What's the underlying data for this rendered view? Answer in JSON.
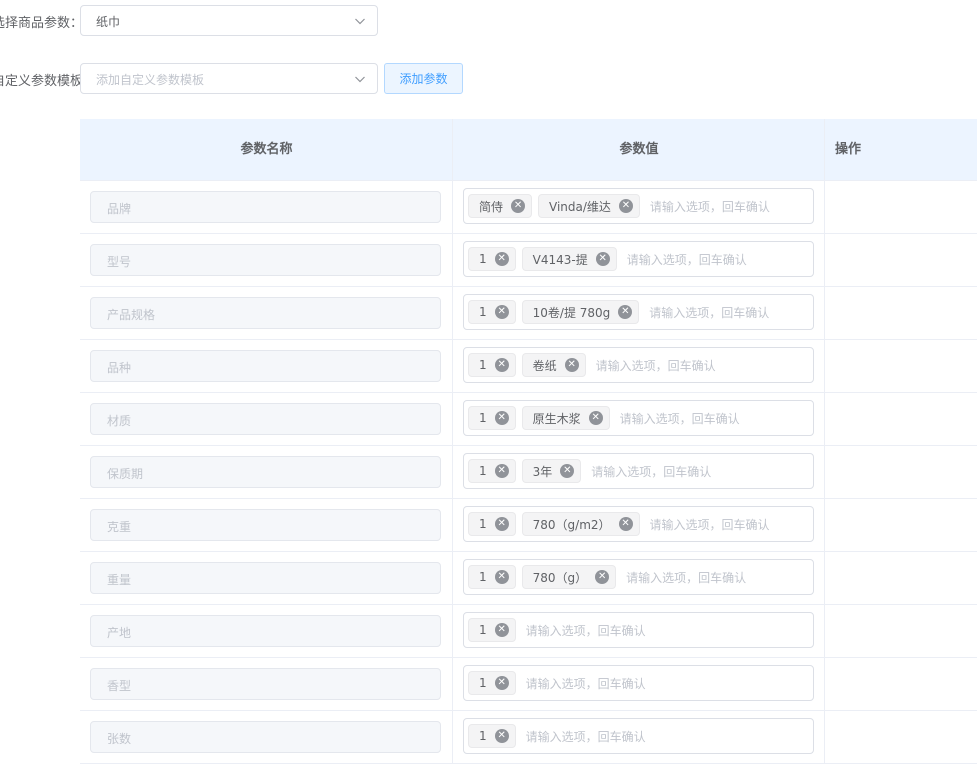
{
  "form": {
    "product_params_label": "选择商品参数：",
    "product_params_value": "纸巾",
    "template_label": "自定义参数模板：",
    "template_placeholder": "添加自定义参数模板",
    "add_button": "添加参数"
  },
  "table": {
    "headers": [
      "参数名称",
      "参数值",
      "操作"
    ],
    "value_placeholder": "请输入选项，回车确认",
    "rows": [
      {
        "name": "品牌",
        "tags": [
          "简侍",
          "Vinda/维达"
        ]
      },
      {
        "name": "型号",
        "tags": [
          "1",
          "V4143-提"
        ]
      },
      {
        "name": "产品规格",
        "tags": [
          "1",
          "10卷/提 780g"
        ]
      },
      {
        "name": "品种",
        "tags": [
          "1",
          "卷纸"
        ]
      },
      {
        "name": "材质",
        "tags": [
          "1",
          "原生木浆"
        ]
      },
      {
        "name": "保质期",
        "tags": [
          "1",
          "3年"
        ]
      },
      {
        "name": "克重",
        "tags": [
          "1",
          "780（g/m2）"
        ]
      },
      {
        "name": "重量",
        "tags": [
          "1",
          "780（g）"
        ]
      },
      {
        "name": "产地",
        "tags": [
          "1"
        ]
      },
      {
        "name": "香型",
        "tags": [
          "1"
        ]
      },
      {
        "name": "张数",
        "tags": [
          "1"
        ]
      }
    ]
  },
  "icons": {
    "dropdown": "chevron-down-icon",
    "tag_close": "close-circle-icon"
  }
}
